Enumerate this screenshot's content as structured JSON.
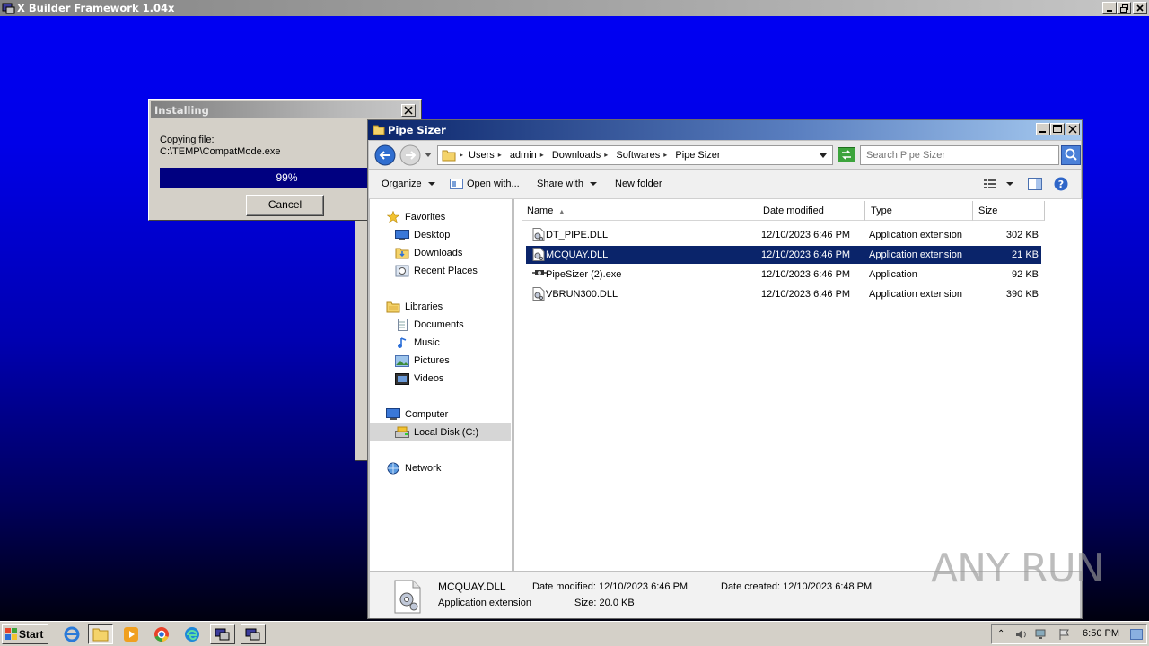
{
  "xbuilder": {
    "title": "X Builder Framework 1.04x"
  },
  "installing": {
    "title": "Installing",
    "copying_label": "Copying file:",
    "file_path": "C:\\TEMP\\CompatMode.exe",
    "progress_text": "99%",
    "progress_value": 0.99,
    "cancel_label": "Cancel"
  },
  "explorer": {
    "title": "Pipe Sizer",
    "breadcrumb": [
      "Users",
      "admin",
      "Downloads",
      "Softwares",
      "Pipe Sizer"
    ],
    "search_placeholder": "Search Pipe Sizer",
    "toolbar": {
      "organize": "Organize",
      "open_with": "Open with...",
      "share_with": "Share with",
      "new_folder": "New folder"
    },
    "nav": {
      "favorites": "Favorites",
      "desktop": "Desktop",
      "downloads": "Downloads",
      "recent": "Recent Places",
      "libraries": "Libraries",
      "documents": "Documents",
      "music": "Music",
      "pictures": "Pictures",
      "videos": "Videos",
      "computer": "Computer",
      "local_disk": "Local Disk (C:)",
      "network": "Network"
    },
    "columns": {
      "name": "Name",
      "date": "Date modified",
      "type": "Type",
      "size": "Size"
    },
    "files": [
      {
        "name": "DT_PIPE.DLL",
        "date": "12/10/2023 6:46 PM",
        "type": "Application extension",
        "size": "302 KB",
        "icon": "dll-icon"
      },
      {
        "name": "MCQUAY.DLL",
        "date": "12/10/2023 6:46 PM",
        "type": "Application extension",
        "size": "21 KB",
        "icon": "dll-icon"
      },
      {
        "name": "PipeSizer (2).exe",
        "date": "12/10/2023 6:46 PM",
        "type": "Application",
        "size": "92 KB",
        "icon": "exe-icon"
      },
      {
        "name": "VBRUN300.DLL",
        "date": "12/10/2023 6:46 PM",
        "type": "Application extension",
        "size": "390 KB",
        "icon": "dll-icon"
      }
    ],
    "selected_index": 1,
    "details": {
      "name": "MCQUAY.DLL",
      "type": "Application extension",
      "date_modified_label": "Date modified:",
      "date_modified": "12/10/2023 6:46 PM",
      "size_label": "Size:",
      "size": "20.0 KB",
      "date_created_label": "Date created:",
      "date_created": "12/10/2023 6:48 PM"
    }
  },
  "watermark": "ANY RUN",
  "taskbar": {
    "start_label": "Start",
    "clock": "6:50 PM"
  },
  "colors": {
    "selection": "#0a246a",
    "progress": "#000080",
    "desktop_top": "#0000f4"
  }
}
